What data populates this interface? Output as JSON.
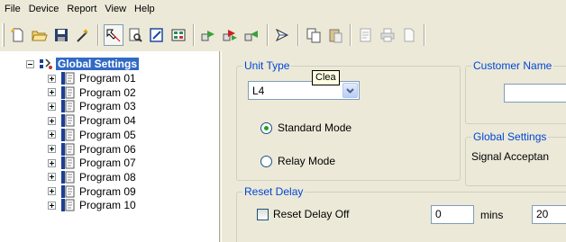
{
  "menu": [
    "File",
    "Device",
    "Report",
    "View",
    "Help"
  ],
  "toolbar": {
    "buttons": [
      {
        "icon": "new-file-icon"
      },
      {
        "icon": "open-folder-icon"
      },
      {
        "icon": "save-icon"
      },
      {
        "icon": "wand-icon"
      },
      {
        "icon": "select-icon"
      },
      {
        "icon": "print-preview-icon"
      },
      {
        "icon": "edit-icon"
      },
      {
        "icon": "grid-icon"
      },
      {
        "icon": "send-icon"
      },
      {
        "icon": "send-receive-icon"
      },
      {
        "icon": "receive-icon"
      },
      {
        "icon": "arrow-icon"
      },
      {
        "icon": "copy-icon"
      },
      {
        "icon": "paste-icon"
      },
      {
        "icon": "document-icon"
      },
      {
        "icon": "print-icon"
      },
      {
        "icon": "page-icon"
      }
    ]
  },
  "tree": {
    "root": {
      "label": "Global Settings"
    },
    "items": [
      {
        "label": "Program 01"
      },
      {
        "label": "Program 02"
      },
      {
        "label": "Program 03"
      },
      {
        "label": "Program 04"
      },
      {
        "label": "Program 05"
      },
      {
        "label": "Program 06"
      },
      {
        "label": "Program 07"
      },
      {
        "label": "Program 08"
      },
      {
        "label": "Program 09"
      },
      {
        "label": "Program 10"
      }
    ]
  },
  "unit_type": {
    "title": "Unit Type",
    "selected": "L4",
    "modes": [
      {
        "label": "Standard Mode",
        "checked": true
      },
      {
        "label": "Relay Mode",
        "checked": false
      }
    ]
  },
  "customer_name": {
    "title": "Customer Name",
    "value": ""
  },
  "tooltip": {
    "text": "Clea"
  },
  "global_settings": {
    "title": "Global Settings",
    "signal_label": "Signal Acceptan"
  },
  "reset_delay": {
    "title": "Reset Delay",
    "off_label": "Reset Delay Off",
    "off_checked": false,
    "value": "0",
    "unit": "mins",
    "value2": "20"
  },
  "colors": {
    "accent": "#316ac5",
    "group_title": "#0046d5",
    "window_bg": "#ece9d8"
  }
}
